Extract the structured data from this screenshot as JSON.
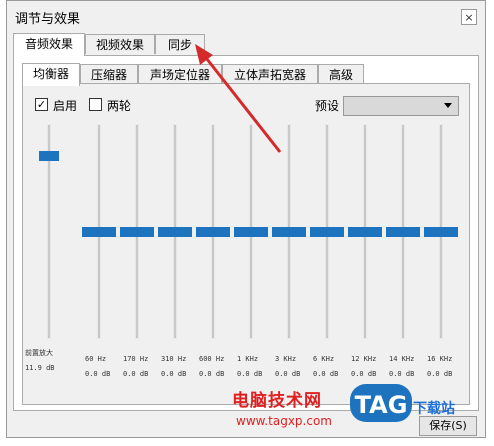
{
  "window": {
    "title": "调节与效果",
    "close": "×"
  },
  "main_tabs": [
    {
      "label": "音频效果",
      "active": true
    },
    {
      "label": "视频效果",
      "active": false
    },
    {
      "label": "同步",
      "active": false
    }
  ],
  "sub_tabs": [
    {
      "label": "均衡器",
      "active": true
    },
    {
      "label": "压缩器",
      "active": false
    },
    {
      "label": "声场定位器",
      "active": false
    },
    {
      "label": "立体声拓宽器",
      "active": false
    },
    {
      "label": "高级",
      "active": false
    }
  ],
  "equalizer": {
    "enable": {
      "label": "启用",
      "checked": true,
      "mark": "✓"
    },
    "two_pass": {
      "label": "两轮",
      "checked": false
    },
    "preset": {
      "label": "预设",
      "value": ""
    },
    "preamp": {
      "label": "前置放大",
      "value": "11.9 dB",
      "level": 0.87
    },
    "bands": [
      {
        "freq": "60 Hz",
        "gain": "0.0 dB",
        "level": 0.5
      },
      {
        "freq": "170 Hz",
        "gain": "0.0 dB",
        "level": 0.5
      },
      {
        "freq": "310 Hz",
        "gain": "0.0 dB",
        "level": 0.5
      },
      {
        "freq": "600 Hz",
        "gain": "0.0 dB",
        "level": 0.5
      },
      {
        "freq": "1 KHz",
        "gain": "0.0 dB",
        "level": 0.5
      },
      {
        "freq": "3 KHz",
        "gain": "0.0 dB",
        "level": 0.5
      },
      {
        "freq": "6 KHz",
        "gain": "0.0 dB",
        "level": 0.5
      },
      {
        "freq": "12 KHz",
        "gain": "0.0 dB",
        "level": 0.5
      },
      {
        "freq": "14 KHz",
        "gain": "0.0 dB",
        "level": 0.5
      },
      {
        "freq": "16 KHz",
        "gain": "0.0 dB",
        "level": 0.5
      }
    ]
  },
  "footer": {
    "save_label": "保存(S)"
  },
  "watermark": {
    "site_name": "电脑技术网",
    "url": "www.tagxp.com",
    "logo_text": "TAG",
    "download_text": "下载站"
  },
  "colors": {
    "thumb": "#1e73be",
    "arrow": "#d42a2a",
    "watermark_red": "#e02020"
  }
}
